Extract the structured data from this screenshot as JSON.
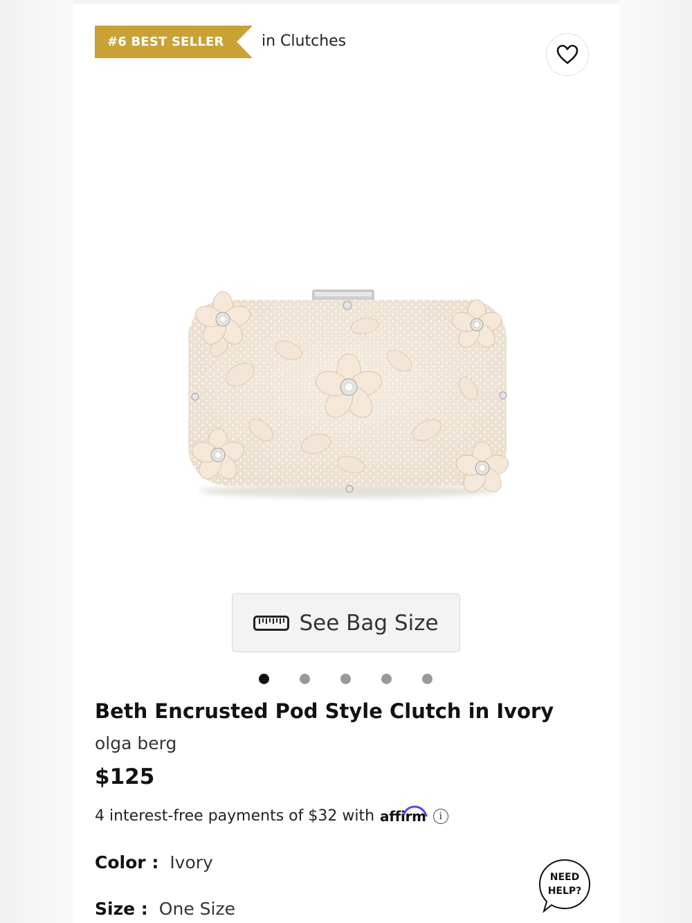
{
  "badge": {
    "label": "#6 BEST SELLER",
    "context": "in Clutches",
    "color": "#c9a236"
  },
  "favorite": {
    "icon": "heart-icon"
  },
  "gallery": {
    "size_button_label": "See Bag Size",
    "size_button_icon": "ruler-icon",
    "slide_count": 5,
    "active_slide": 1
  },
  "product": {
    "title": "Beth Encrusted Pod Style Clutch in Ivory",
    "brand": "olga berg",
    "price": "$125"
  },
  "financing": {
    "text": "4 interest-free payments of $32 with",
    "provider": "affirm",
    "info_icon": "info-icon"
  },
  "options": {
    "color_label": "Color",
    "color_value": "Ivory",
    "size_label": "Size",
    "size_value": "One Size"
  },
  "help": {
    "line1": "NEED",
    "line2": "HELP?"
  }
}
